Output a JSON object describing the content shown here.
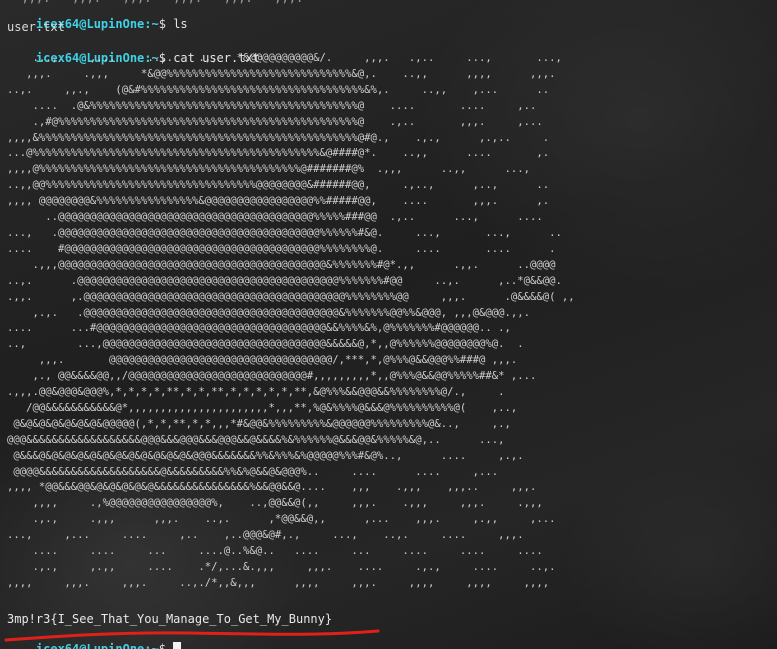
{
  "terminal": {
    "prompt_user_host": "icex64@LupinOne",
    "prompt_path": ":~",
    "prompt_symbol": "$",
    "command1": " ls",
    "ls_output": "user.txt",
    "command2": " cat user.txt",
    "ascii_art": "    ...,     ,...     ..,.    .,,   *&@@@@@@@@@@&/.     ,,,.   .,..     ...,       ...,\n   ,,,.     .,,,     *&@@%%%%%%%%%%%%%%%%%%%%%%%%%%%%%&@,.    ..,,      ,,,,      ,,,.\n..,.     ,,.,    (@&#%%%%%%%%%%%%%%%%%%%%%%%%%%%%%%%%%%%&%,.     ..,,    ,...      ..\n    ....  .@&%%%%%%%%%%%%%%%%%%%%%%%%%%%%%%%%%%%%%%%%%%@    ....       ....     ,..\n    .,#@%%%%%%%%%%%%%%%%%%%%%%%%%%%%%%%%%%%%%%%%%%%%%%%@    .,..       ,,,.     ,...\n,,,,&%%%%%%%%%%%%%%%%%%%%%%%%%%%%%%%%%%%%%%%%%%%%%%%%%%@#@.,    .,.,      ,.,..     .\n...@%%%%%%%%%%%%%%%%%%%%%%%%%%%%%%%%%%%%%%%%%%%%%&@####@*.    ..,,      ....       ,.\n,,,,@%%%%%%%%%%%%%%%%%%%%%%%%%%%%%%%%%%%%%%%%%@#######@%  .,,,      ..,,      ...,\n..,,@@%%%%%%%%%%%%%%%%%%%%%%%%%%%%%%%%%@@@@@@@@&######@@,     .,..,      ,..,      ..\n,,,, @@@@@@@@&%%%%%%%%%%%%%%%%&@@@@@@@@@@@@@@@@@%%#####@@,    ....       ,,,.      ,.\n      ..@@@@@@@@@@@@@@@@@@@@@@@@@@@@@@@@@@@@@@@@%%%%%###@@  .,..      ...,      ....\n...,   .@@@@@@@@@@@@@@@@@@@@@@@@@@@@@@@@@@@@@@@@@%%%%%%#&@.     ...,       ...,      ..\n....    #@@@@@@@@@@@@@@@@@@@@@@@@@@@@@@@@@@@@@@@@%%%%%%%%@.     ....       ....      .\n    .,,,@@@@@@@@@@@@@@@@@@@@@@@@@@@@@@@@@@@@@@@@@@&%%%%%%%#@*.,,      .,,.      ..@@@@\n..,.      .@@@@@@@@@@@@@@@@@@@@@@@@@@@@@@@@@@@@@@@@@%%%%%%%#@@     ..,.      ,..*@&&@@.\n.,,.      ,.@@@@@@@@@@@@@@@@@@@@@@@@@@@@@@@@@@@@@@@@@%%%%%%%%@@     ,,,.      .@&&&&@( ,,\n    ,.,.   .@@@@@@@@@@@@@@@@@@@@@@@@@@@@@@@@@@@@@@@@&%%%%%%%@@%%&@@@, ,,,@&@@@.,,.\n....      ...#@@@@@@@@@@@@@@@@@@@@@@@@@@@@@@@@@@@@&&%%%%&%,@%%%%%%%#@@@@@@.. .,\n..,        ...,@@@@@@@@@@@@@@@@@@@@@@@@@@@@@@@@@@@&&&&&@,*,,@%%%%%%@@@@@@@@%@.  .\n     ,,,.       @@@@@@@@@@@@@@@@@@@@@@@@@@@@@@@@@@@/,***,*,@%%%@&&@@@%%###@ ,,,.\n    ,., @@&&&&@@,,/@@@@@@@@@@@@@@@@@@@@@@@@@@@@#,,,,,,,,,*,,@%%%@&&@@%%%%%##&* ,...\n.,,,.@@&@@@&@@@%,*,*,*,*,**,*,*,**,*,*,*,*,*,**,&@%%%&&@@@&&%%%%%%%%@/.,     .\n   /@@&&&&&&&&&&&@*,,,,,,,,,,,,,,,,,,,,,,*,,,**,%@&%%%%@&&&@%%%%%%%%%%@(    ,..,\n @&@&@&@&@&@&@&@@@@@(,*,*,**,*,*,,,*#&@@&%%%%%%%%%&@@@@@@%%%%%%%%%@&..,     ,.,\n@@@&&&&&&&&&&&&&&&&&&@@@&&&@@@&&&@@@&&@&&&&%&%%%%%%@&&&@@&%%%%%&@,..      ...,\n @&&&@&@&@&@&@&@&@&@&@&@&@&@&@@@&&&&&&&%%&%%%&%@@@@@%%%#&@%..,      ....     ,.,.\n @@@@&&&&&&&&&&&&&&&&&&&@&&&&&&&&&%%&%@&&@&@@@%..     ....      ....     ,...\n,,,, *@@&&&@@&@&@&@&@&@&&&&&&&&&&&&&&&%&&@@&&@....    ,,,    .,,,    ,,,..     ,,,.\n    ,,,,     .,%@@@@@@@@@@@@@@@@%,    ..,@@&&@(,,     ,,,.    .,,,     ,,,.     .,,,\n    .,.,     .,,,      ,,,.    ..,.      ,*@@&&@,,      ,...    ,,,.     ,.,,     ,...\n...,     ,...     ....     ,..    ,..@@@&@#,.,     ...,    ..,.     ....     ,,,.\n    ....     ....     ...     ....@..%&@..   ....     ...     ....     ....     ....\n    .,.,     ,.,,     ....    .*/,...&.,,,     ,,,.    ....     .,.,     ....     ..,.\n,,,,     ,,,.     ,,,.     ..,./*,,&,,,      ,,,,     ,,,.     ,,,,     ,,,,     ,,,,",
    "flag": "3mp!r3{I_See_That_You_Manage_To_Get_My_Bunny}",
    "cutoff_top": "  ,,,.   ,,,.   ,,,.   ,,,.   ,,,.   ,,,."
  },
  "colors": {
    "prompt": "#3fd1e6",
    "underline": "#e0201a",
    "text": "#e6e6e6"
  }
}
